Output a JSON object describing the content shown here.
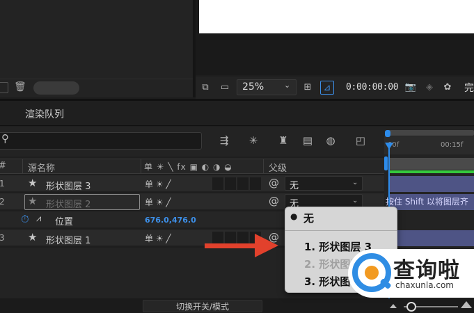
{
  "viewer": {
    "zoom": "25%",
    "timecode": "0:00:00:00",
    "end_label": "完"
  },
  "render_queue": {
    "tab_label": "渲染队列"
  },
  "columns": {
    "source_name": "源名称",
    "switches": "单 ☀ ╲ fx ▣ ◐ ◑ ◒",
    "parent": "父级"
  },
  "layers": [
    {
      "index": "1",
      "name": "形状图层 3",
      "parent": "无"
    },
    {
      "index": "2",
      "name": "形状图层 2",
      "parent": "无"
    },
    {
      "index": "3",
      "name": "形状图层 1"
    }
  ],
  "position_property": {
    "label": "位置",
    "value": "676.0,476.0"
  },
  "parent_menu": {
    "selected": "无",
    "items": [
      {
        "label": "1. 形状图层 3",
        "enabled": true
      },
      {
        "label": "2. 形状图层",
        "enabled": false
      },
      {
        "label": "3. 形状图",
        "enabled": true
      }
    ]
  },
  "timeline": {
    "ruler_start": "00f",
    "ruler_mark": "00:15f",
    "tip": "按住 Shift 以将图层齐"
  },
  "bottom": {
    "toggle_label": "切换开关/模式"
  },
  "watermark": {
    "title": "查询啦",
    "url": "chaxunla.com"
  },
  "colors": {
    "accent": "#2d8ceb",
    "arrow": "#e2412c",
    "layer_bar": "#4e5485",
    "work_green": "#35c93d"
  },
  "icons": [
    "trash-icon",
    "search-icon",
    "snapshot-icon",
    "solo-icon",
    "graph-icon",
    "stopwatch-icon",
    "pickwhip-icon",
    "star-icon"
  ]
}
